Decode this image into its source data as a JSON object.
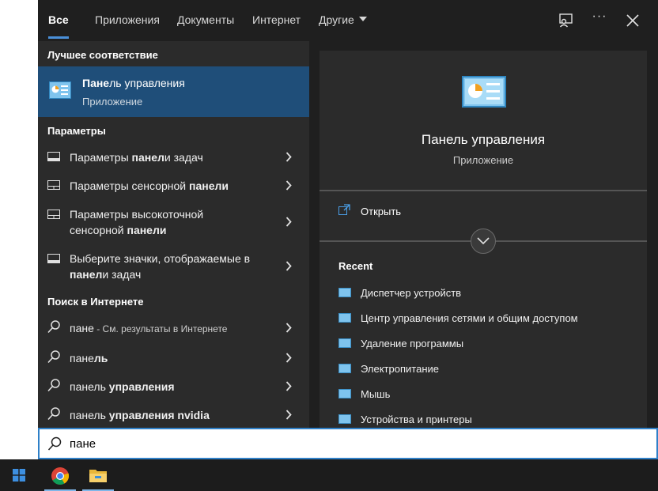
{
  "tabs": [
    {
      "label": "Все"
    },
    {
      "label": "Приложения"
    },
    {
      "label": "Документы"
    },
    {
      "label": "Интернет"
    },
    {
      "label": "Другие"
    }
  ],
  "top_icons": [
    "feedback-icon",
    "more-icon",
    "close-icon"
  ],
  "more_label": "···",
  "best_match": {
    "header": "Лучшее соответствие",
    "title_bold": "Пане",
    "title_rest": "ль управления",
    "subtitle": "Приложение"
  },
  "settings": {
    "header": "Параметры",
    "items": [
      {
        "line1_pre": "Параметры ",
        "line1_bold": "панел",
        "line1_post": "и задач",
        "line2_pre": "",
        "line2_bold": "",
        "line2_post": ""
      },
      {
        "line1_pre": "Параметры сенсорной ",
        "line1_bold": "панели",
        "line1_post": "",
        "line2_pre": "",
        "line2_bold": "",
        "line2_post": ""
      },
      {
        "line1_pre": "Параметры высокоточной",
        "line1_bold": "",
        "line1_post": "",
        "line2_pre": "сенсорной ",
        "line2_bold": "панели",
        "line2_post": ""
      },
      {
        "line1_pre": "Выберите значки, отображаемые в",
        "line1_bold": "",
        "line1_post": "",
        "line2_pre": "",
        "line2_bold": "панел",
        "line2_post": "и задач"
      }
    ]
  },
  "web": {
    "header": "Поиск в Интернете",
    "items": [
      {
        "pre": "пане",
        "bold": "",
        "small": " - См. результаты в Интернете"
      },
      {
        "pre": "пане",
        "bold": "ль",
        "small": ""
      },
      {
        "pre": "панель ",
        "bold": "управления",
        "small": ""
      },
      {
        "pre": "панель ",
        "bold": "управления nvidia",
        "small": ""
      }
    ]
  },
  "preview": {
    "title": "Панель управления",
    "subtitle": "Приложение",
    "open_label": "Открыть",
    "recent_header": "Recent",
    "recent": [
      "Диспетчер устройств",
      "Центр управления сетями и общим доступом",
      "Удаление программы",
      "Электропитание",
      "Мышь",
      "Устройства и принтеры"
    ]
  },
  "search": {
    "query": "пане"
  },
  "taskbar": {
    "apps": [
      "start-icon",
      "chrome-icon",
      "file-explorer-icon"
    ]
  },
  "colors": {
    "accent": "#4a90d9",
    "selected_bg": "#1f4e79",
    "search_border": "#2f80c8"
  }
}
